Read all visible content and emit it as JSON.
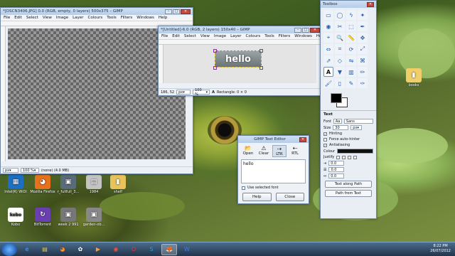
{
  "window1": {
    "title": "*[DSCN3406.JPG] 0.0 (RGB, empty, 0 layers) 500x375 – GIMP",
    "menu": [
      "File",
      "Edit",
      "Select",
      "View",
      "Image",
      "Layer",
      "Colours",
      "Tools",
      "Filters",
      "Windows",
      "Help"
    ],
    "status": {
      "unit": "px",
      "zoom": "100 %",
      "info": "(none) (4.0 MB)"
    }
  },
  "window2": {
    "title": "*[Untitled]-6.0 (RGB, 2 layers) 150x40 – GIMP",
    "menu": [
      "File",
      "Edit",
      "Select",
      "View",
      "Image",
      "Layer",
      "Colours",
      "Tools",
      "Filters",
      "Windows",
      "Help"
    ],
    "canvas_text": "hello",
    "status": {
      "coords": "186, 52",
      "unit": "px",
      "zoom": "100 %",
      "info": "Rectangle: 0 × 0"
    }
  },
  "toolbox": {
    "title": "Toolbox",
    "tool_icons": [
      "rect-select-icon",
      "ellipse-select-icon",
      "free-select-icon",
      "fuzzy-select-icon",
      "color-select-icon",
      "scissors-icon",
      "foreground-select-icon",
      "paths-icon",
      "color-picker-icon",
      "zoom-icon",
      "measure-icon",
      "move-icon",
      "align-icon",
      "crop-icon",
      "rotate-icon",
      "scale-icon",
      "shear-icon",
      "perspective-icon",
      "flip-icon",
      "cage-icon",
      "text-icon",
      "bucket-fill-icon",
      "blend-icon",
      "pencil-icon",
      "paintbrush-icon",
      "eraser-icon",
      "airbrush-icon",
      "ink-icon",
      "clone-icon",
      "heal-icon",
      "perspective-clone-icon",
      "blur-icon",
      "smudge-icon",
      "dodge-burn-icon"
    ],
    "tool_glyphs": [
      "▭",
      "◯",
      "ϟ",
      "✦",
      "◉",
      "✂",
      "⬚",
      "✒",
      "⌖",
      "🔍",
      "📏",
      "✥",
      "⇔",
      "⌗",
      "⟳",
      "⤢",
      "⇗",
      "◇",
      "⇋",
      "⌘",
      "A",
      "▼",
      "▥",
      "✏",
      "🖌",
      "▯",
      "✎",
      "✑",
      "⎘",
      "✚",
      "⧉",
      "💧",
      "☝",
      "◐"
    ],
    "selected_tool_index": 20,
    "options_title": "Text",
    "font_label": "Font",
    "font_value": "Sans",
    "size_label": "Size",
    "size_value": "30",
    "size_unit": "px",
    "hinting_label": "Hinting",
    "force_autohinter_label": "Force auto-hinter",
    "antialiasing_label": "Antialiasing",
    "colour_label": "Colour",
    "justify_label": "Justify",
    "indent_value": "0.0",
    "line_spacing_value": "0.0",
    "letter_spacing_value": "0.0",
    "text_along_path": "Text along Path",
    "path_from_text": "Path from Text",
    "fg_color": "#000000",
    "bg_color": "#ffffff"
  },
  "text_editor": {
    "title": "GIMP Text Editor",
    "open": "Open",
    "clear": "Clear",
    "ltr": "LTR",
    "rtl": "RTL",
    "content": "hello",
    "use_selected_font": "Use selected font",
    "help": "Help",
    "close": "Close"
  },
  "desktop_icons": [
    {
      "label": "Intel(R) WiDi",
      "glyph": "▦",
      "color": "#1d6fc1"
    },
    {
      "label": "Mozilla Firefox",
      "glyph": "◕",
      "color": "#e6721e"
    },
    {
      "label": "r_fullfull_3...",
      "glyph": "▣",
      "color": "#5a6b7a"
    },
    {
      "label": "1984",
      "glyph": "▤",
      "color": "#c4c4c4"
    },
    {
      "label": "shelf",
      "glyph": "▮",
      "color": "#e8c25a"
    },
    {
      "label": "Kobo",
      "glyph": "kobo",
      "color": "#ffffff"
    },
    {
      "label": "BitTorrent",
      "glyph": "↻",
      "color": "#6a3fb1"
    },
    {
      "label": "week 2 991",
      "glyph": "▣",
      "color": "#777777"
    },
    {
      "label": "garden-ob...",
      "glyph": "▣",
      "color": "#888888"
    },
    {
      "label": "books",
      "glyph": "▮",
      "color": "#f0cf6a"
    }
  ],
  "taskbar": {
    "apps": [
      {
        "name": "ie-icon",
        "glyph": "e",
        "color": "#4aa3ff"
      },
      {
        "name": "explorer-icon",
        "glyph": "▤",
        "color": "#f0c040"
      },
      {
        "name": "firefox-icon",
        "glyph": "◕",
        "color": "#ff8a1e"
      },
      {
        "name": "picasa-icon",
        "glyph": "✿",
        "color": "#ffffff"
      },
      {
        "name": "media-player-icon",
        "glyph": "▶",
        "color": "#ff9b2b"
      },
      {
        "name": "chrome-icon",
        "glyph": "◉",
        "color": "#ff4a3a"
      },
      {
        "name": "opera-icon",
        "glyph": "O",
        "color": "#ff2a2a"
      },
      {
        "name": "skype-icon",
        "glyph": "S",
        "color": "#1aa7e6"
      },
      {
        "name": "gimp-icon",
        "glyph": "🦊",
        "color": "#c9a46b"
      },
      {
        "name": "word-icon",
        "glyph": "W",
        "color": "#3b7be8"
      }
    ],
    "time": "8:22 PM",
    "date": "26/07/2012"
  }
}
